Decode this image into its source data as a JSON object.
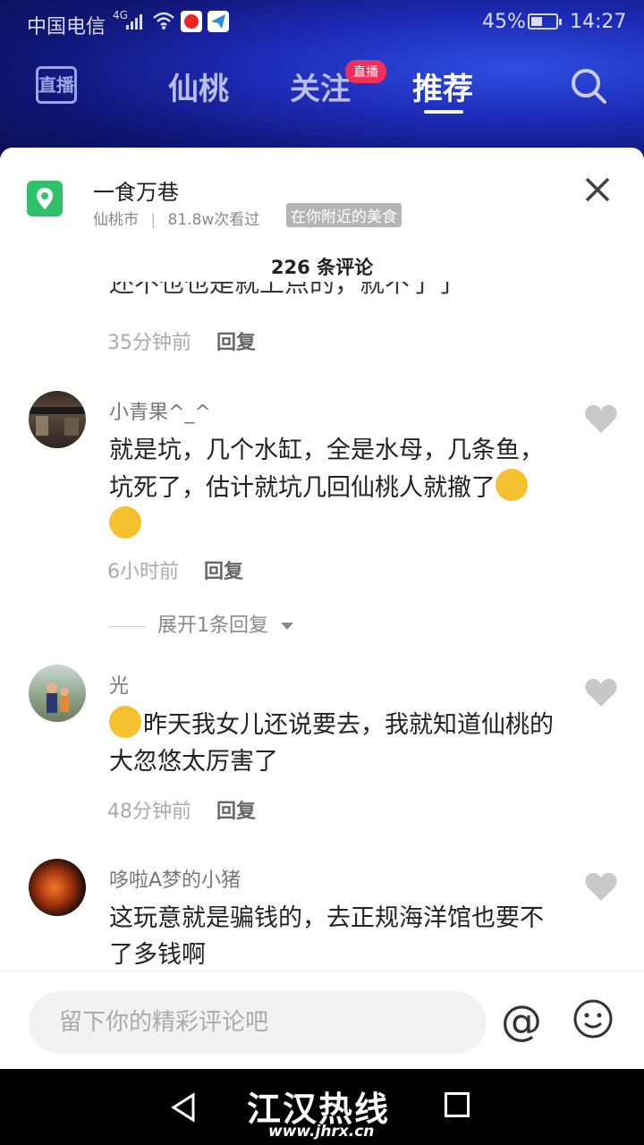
{
  "status_bar": {
    "carrier": "中国电信",
    "network": "4G",
    "battery_percent": "45%",
    "battery_level": 0.45,
    "time": "14:27"
  },
  "top_nav": {
    "live_icon_label": "直播",
    "tabs": [
      {
        "label": "仙桃",
        "active": false
      },
      {
        "label": "关注",
        "active": false,
        "badge": "直播"
      },
      {
        "label": "推荐",
        "active": true
      }
    ],
    "search_icon": "search-icon"
  },
  "location": {
    "title": "一食万巷",
    "city": "仙桃市",
    "views": "81.8w次看过",
    "tag": "在你附近的美食"
  },
  "comments_header": {
    "count_text": "226 条评论"
  },
  "comments": [
    {
      "partial_text": "还不也也是就上点的，就不了了",
      "time": "35分钟前",
      "reply_label": "回复"
    },
    {
      "username": "小青果^_^",
      "text": "就是坑，几个水缸，全是水母，几条鱼，坑死了，估计就坑几回仙桃人就撤了",
      "emoji_count": 2,
      "time": "6小时前",
      "reply_label": "回复",
      "expand_label": "展开1条回复"
    },
    {
      "username": "光",
      "text": "昨天我女儿还说要去，我就知道仙桃的大忽悠太厉害了",
      "lead_emoji": true,
      "time": "48分钟前",
      "reply_label": "回复"
    },
    {
      "username": "哆啦A梦的小猪",
      "text": "这玩意就是骗钱的，去正规海洋馆也要不了多钱啊"
    }
  ],
  "input_bar": {
    "placeholder": "留下你的精彩评论吧",
    "at_symbol": "@"
  },
  "watermark": {
    "name": "江汉热线",
    "url": "www.jhrx.cn"
  }
}
